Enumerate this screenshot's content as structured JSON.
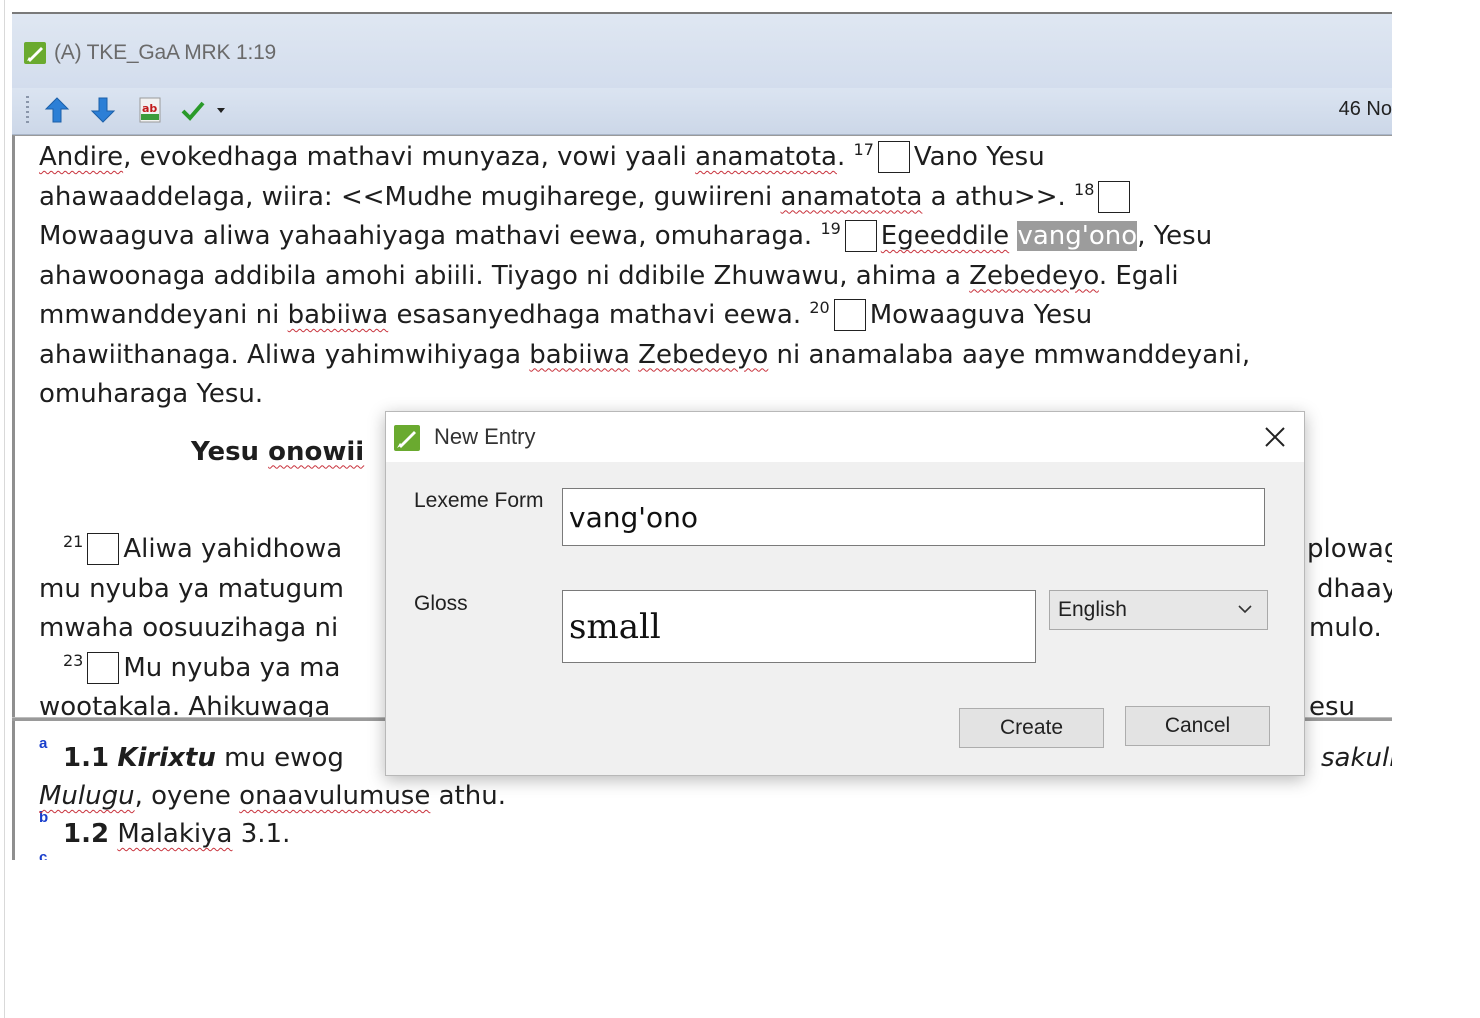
{
  "window": {
    "title": "(A) TKE_GaA MRK 1:19",
    "count_text": "46 No"
  },
  "toolbar": {
    "icons": [
      "arrow-up-icon",
      "arrow-down-icon",
      "spelling-icon",
      "checkmark-icon",
      "dropdown-arrow-icon"
    ]
  },
  "scripture": {
    "lines": [
      [
        "Andire",
        ", evokedhaga mathavi munyaza, vowi yaali ",
        "anamatota",
        ". ",
        "17",
        "Vano Yesu"
      ],
      [
        "ahawaaddelaga, wiira: <<Mudhe mugiharege, guwiireni ",
        "anamatota",
        " a athu>>. ",
        "18"
      ],
      [
        "Mowaaguva aliwa yahaahiyaga mathavi eewa, omuharaga. ",
        "19",
        "Egeeddile",
        "vang'ono",
        ", Yesu"
      ],
      [
        "ahawoonaga addibila amohi abiili. Tiyago ni ddibile Zhuwawu, ahima a ",
        "Zebedeyo",
        ". Egali"
      ],
      [
        "mmwanddeyani ni ",
        "babiiwa",
        " esasanyedhaga mathavi eewa. ",
        "20",
        "Mowaaguva Yesu"
      ],
      [
        "ahawiithanaga. Aliwa yahimwihiyaga ",
        "babiiwa",
        "Zebedeyo",
        " ni anamalaba aaye mmwanddeyani,"
      ],
      [
        "omuharaga Yesu."
      ],
      [
        "Yesu ",
        "onowii"
      ],
      [
        ""
      ],
      [
        "21",
        "Aliwa yahidhowa",
        "plowag"
      ],
      [
        "mu nyuba ya matugum",
        "dhaay"
      ],
      [
        "mwaha oosuuzihaga ni",
        "mulo."
      ],
      [
        "23",
        "Mu nyuba ya ma"
      ],
      [
        "wootakala. Ahikuwaga",
        "esu"
      ]
    ]
  },
  "notes": {
    "marks": [
      "a",
      "b",
      "c"
    ],
    "line1": [
      "1.1",
      "Kirixtu",
      " mu ewog",
      "sakuli"
    ],
    "line2": [
      "Mulugu",
      ", oyene ",
      "onaavulumuse",
      " athu."
    ],
    "line3": [
      "1.2",
      "Malakiya",
      " 3.1."
    ]
  },
  "dialog": {
    "title": "New Entry",
    "close_label": "✕",
    "lexeme_label": "Lexeme Form",
    "lexeme_value": "vang'ono",
    "gloss_label": "Gloss",
    "gloss_value": "small",
    "language_selected": "English",
    "create_label": "Create",
    "cancel_label": "Cancel"
  }
}
